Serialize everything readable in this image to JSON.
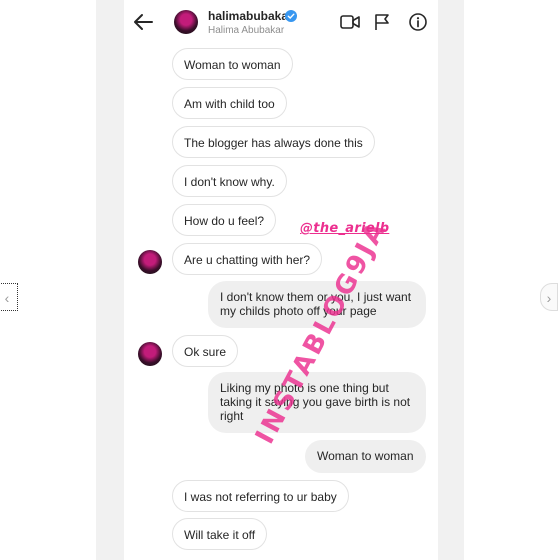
{
  "header": {
    "username": "halimabubakar",
    "full_name": "Halima Abubakar",
    "icons": [
      "back-arrow-icon",
      "verified-icon",
      "video-call-icon",
      "flag-icon",
      "info-icon"
    ]
  },
  "watermark": {
    "handle": "@the_arielb",
    "main": "INSTABLOG9JA"
  },
  "messages": [
    {
      "side": "received",
      "text": "Woman to woman"
    },
    {
      "side": "received",
      "text": "Am with child too"
    },
    {
      "side": "received",
      "text": "The blogger has always done this"
    },
    {
      "side": "received",
      "text": "I don't know why."
    },
    {
      "side": "received",
      "text": "How do u feel?"
    },
    {
      "side": "received",
      "text": "Are u chatting with her?"
    },
    {
      "side": "sent",
      "text": "I don't know them or you, I just want my childs photo off your page"
    },
    {
      "side": "received",
      "text": "Ok sure"
    },
    {
      "side": "sent",
      "text": "Liking my photo is one thing but taking it saying you gave birth is not right"
    },
    {
      "side": "sent",
      "text": "Woman to woman"
    },
    {
      "side": "received",
      "text": "I was not referring to ur baby"
    },
    {
      "side": "received",
      "text": "Will take it off"
    }
  ],
  "colors": {
    "watermark": "#ec2f8f",
    "sent_bubble": "#efefef",
    "received_border": "#e2e2e2",
    "verified": "#3897f0"
  }
}
